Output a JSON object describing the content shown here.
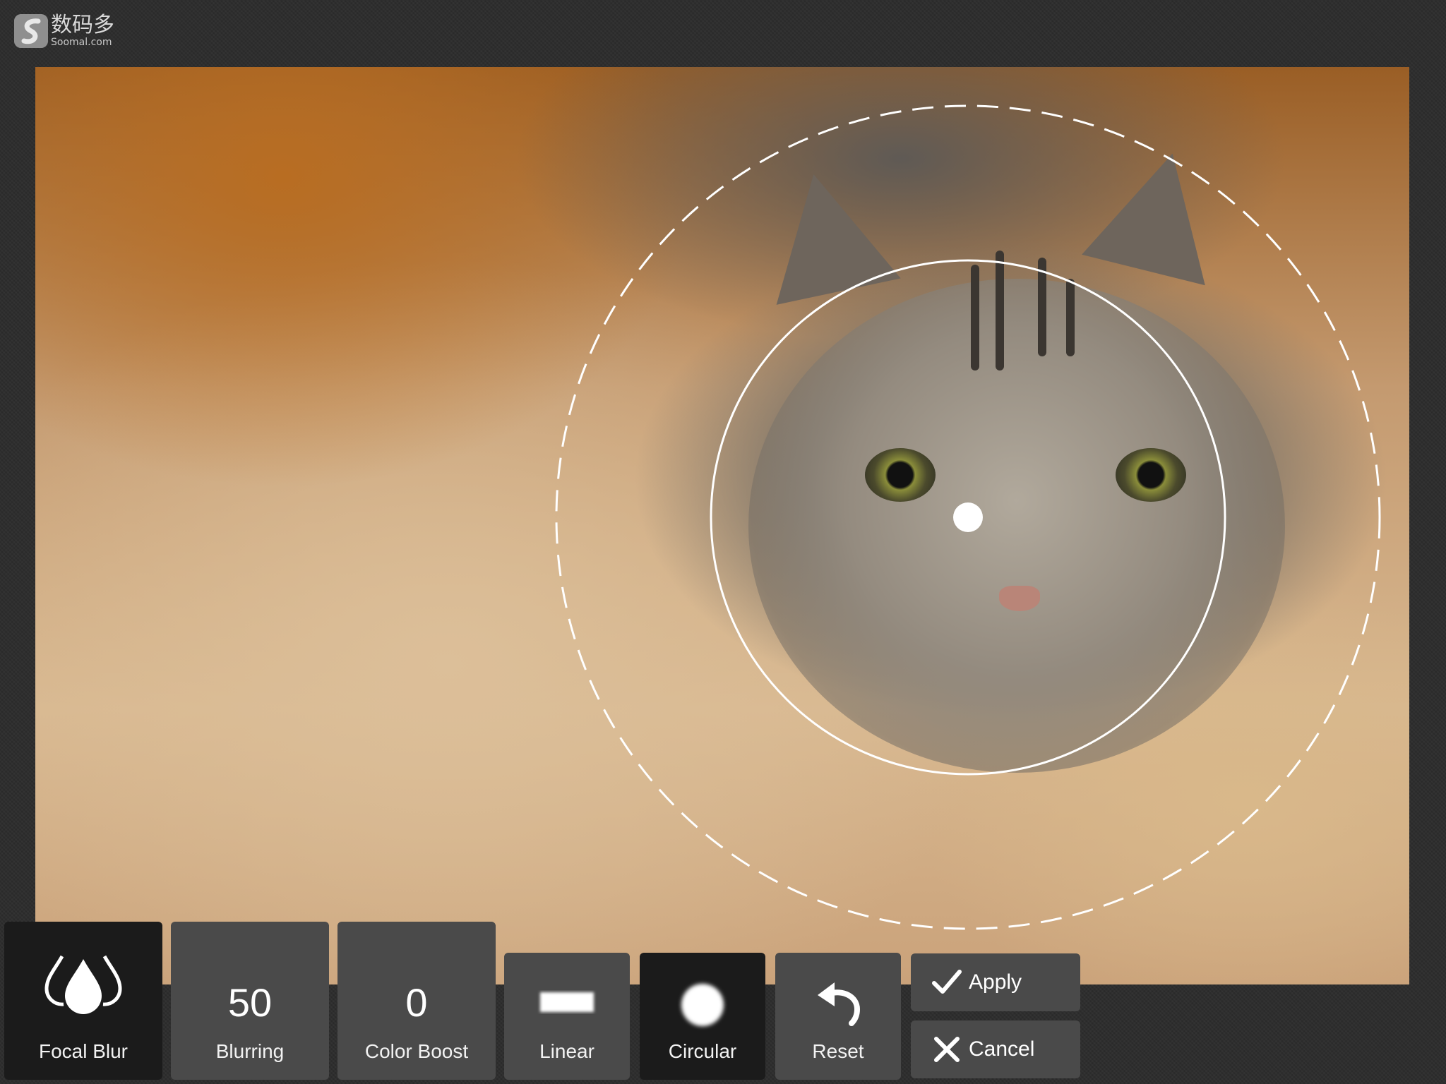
{
  "watermark": {
    "title": "数码多",
    "subtitle": "Soomal.com"
  },
  "editor": {
    "tool": "Focal Blur",
    "focus_shape": "Circular",
    "image_description": "photo of a gray tabby cat on a beige cushion"
  },
  "toolbar": {
    "focal_blur_label": "Focal Blur",
    "blurring_value": "50",
    "blurring_label": "Blurring",
    "color_boost_value": "0",
    "color_boost_label": "Color Boost",
    "linear_label": "Linear",
    "circular_label": "Circular",
    "reset_label": "Reset",
    "apply_label": "Apply",
    "cancel_label": "Cancel"
  },
  "colors": {
    "button_bg": "#4a4a4a",
    "button_active_bg": "#1b1b1b",
    "text": "#ffffff"
  }
}
